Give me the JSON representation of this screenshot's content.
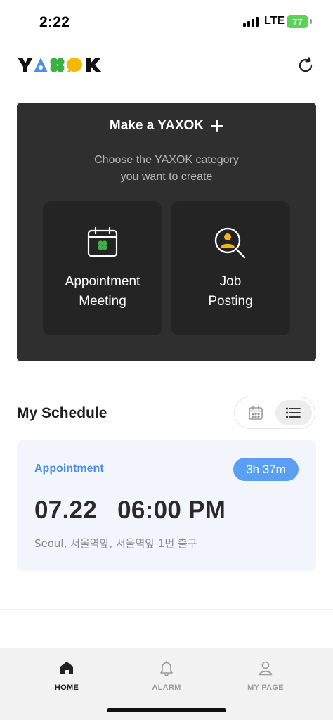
{
  "status_bar": {
    "time": "2:22",
    "network": "LTE",
    "battery": "77"
  },
  "header": {
    "logo_text": "YAXOK",
    "refresh_icon": "refresh-icon"
  },
  "create_card": {
    "title": "Make a YAXOK",
    "plus_icon": "plus-icon",
    "subtitle_line1": "Choose the YAXOK category",
    "subtitle_line2": "you want to create",
    "options": [
      {
        "icon": "calendar-clover-icon",
        "line1": "Appointment",
        "line2": "Meeting"
      },
      {
        "icon": "person-search-icon",
        "line1": "Job",
        "line2": "Posting"
      }
    ]
  },
  "schedule": {
    "title": "My Schedule",
    "view_toggle": {
      "calendar_icon": "calendar-icon",
      "list_icon": "list-icon",
      "selected": "list"
    },
    "items": [
      {
        "type": "Appointment",
        "remaining": "3h 37m",
        "date": "07.22",
        "time": "06:00 PM",
        "location": "Seoul, 서울역앞, 서울역앞 1번 출구"
      }
    ]
  },
  "bottom_nav": {
    "items": [
      {
        "label": "HOME",
        "icon": "home-icon",
        "active": true
      },
      {
        "label": "ALARM",
        "icon": "bell-icon",
        "active": false
      },
      {
        "label": "MY PAGE",
        "icon": "person-icon",
        "active": false
      }
    ]
  },
  "colors": {
    "accent_blue": "#4a90e2",
    "badge_blue": "#5aa0f2",
    "card_dark": "#2f2f2f",
    "logo_yellow": "#f5b800",
    "logo_blue": "#4a8ef0",
    "logo_green": "#3cb043",
    "battery_green": "#5dd25b"
  }
}
